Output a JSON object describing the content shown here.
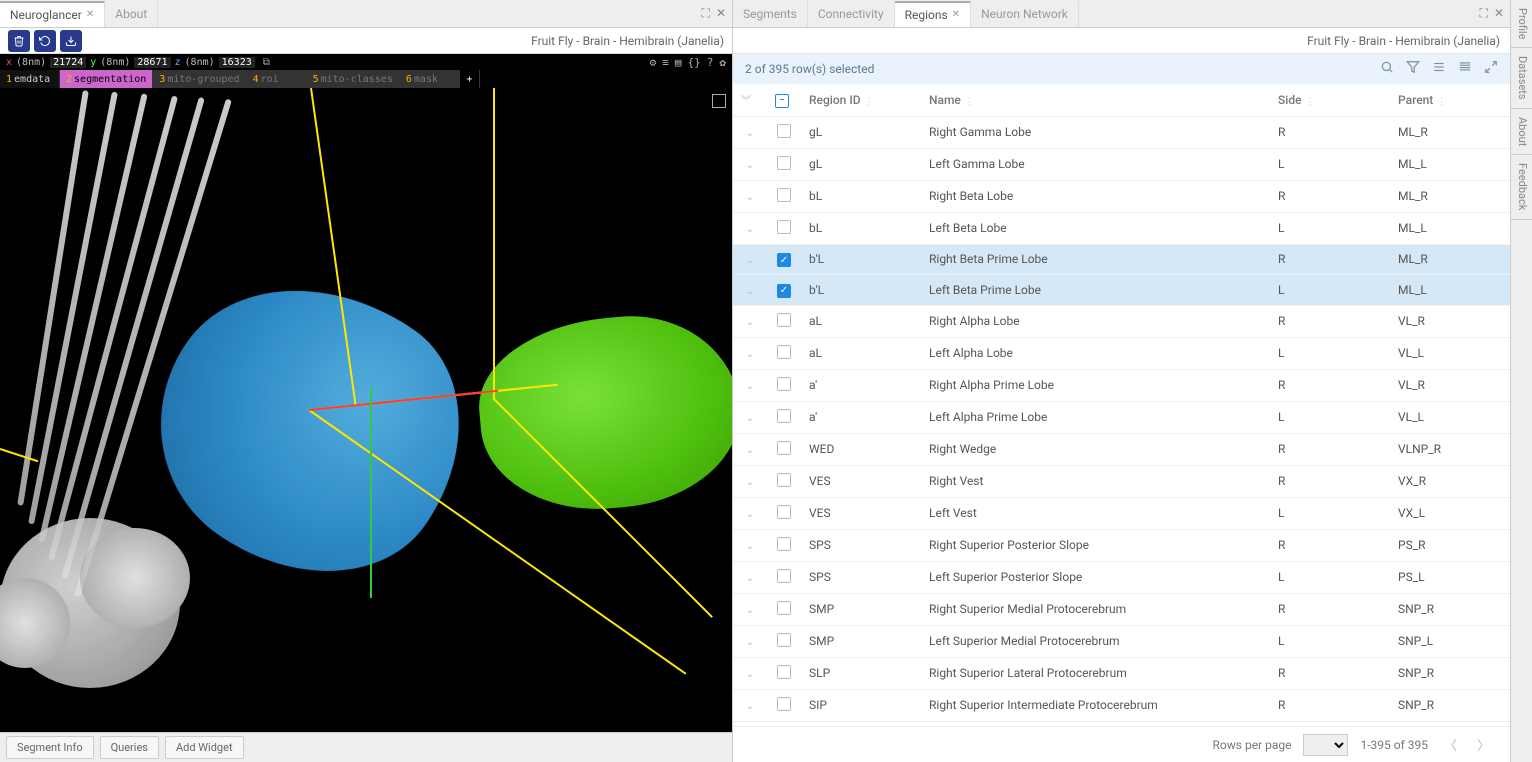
{
  "left": {
    "tabs": [
      {
        "label": "Neuroglancer",
        "active": true,
        "closeable": true
      },
      {
        "label": "About",
        "active": false,
        "closeable": false
      }
    ],
    "breadcrumb": "Fruit Fly - Brain - Hemibrain (Janelia)",
    "coord": {
      "x": {
        "label": "x",
        "unit": "(8nm)",
        "value": "21724"
      },
      "y": {
        "label": "y",
        "unit": "(8nm)",
        "value": "28671"
      },
      "z": {
        "label": "z",
        "unit": "(8nm)",
        "value": "16323"
      }
    },
    "layers": [
      {
        "num": "1",
        "name": "emdata",
        "cls": "emdata"
      },
      {
        "num": "2",
        "name": "segmentation",
        "cls": "seg"
      },
      {
        "num": "3",
        "name": "mito-grouped",
        "cls": "faded"
      },
      {
        "num": "4",
        "name": "roi",
        "cls": "faded"
      },
      {
        "num": "5",
        "name": "mito-classes",
        "cls": "faded"
      },
      {
        "num": "6",
        "name": "mask",
        "cls": "faded"
      }
    ],
    "bottomButtons": [
      "Segment Info",
      "Queries",
      "Add Widget"
    ]
  },
  "right": {
    "tabs": [
      {
        "label": "Segments",
        "active": false
      },
      {
        "label": "Connectivity",
        "active": false
      },
      {
        "label": "Regions",
        "active": true,
        "closeable": true
      },
      {
        "label": "Neuron Network",
        "active": false
      }
    ],
    "breadcrumb": "Fruit Fly - Brain - Hemibrain (Janelia)",
    "selectionText": "2 of 395 row(s) selected",
    "columns": [
      "Region ID",
      "Name",
      "Side",
      "Parent"
    ],
    "rows": [
      {
        "id": "gL",
        "name": "Right Gamma Lobe",
        "side": "R",
        "parent": "ML_R",
        "selected": false
      },
      {
        "id": "gL",
        "name": "Left Gamma Lobe",
        "side": "L",
        "parent": "ML_L",
        "selected": false
      },
      {
        "id": "bL",
        "name": "Right Beta Lobe",
        "side": "R",
        "parent": "ML_R",
        "selected": false
      },
      {
        "id": "bL",
        "name": "Left Beta Lobe",
        "side": "L",
        "parent": "ML_L",
        "selected": false
      },
      {
        "id": "b'L",
        "name": "Right Beta Prime Lobe",
        "side": "R",
        "parent": "ML_R",
        "selected": true
      },
      {
        "id": "b'L",
        "name": "Left Beta Prime Lobe",
        "side": "L",
        "parent": "ML_L",
        "selected": true
      },
      {
        "id": "aL",
        "name": "Right Alpha Lobe",
        "side": "R",
        "parent": "VL_R",
        "selected": false
      },
      {
        "id": "aL",
        "name": "Left Alpha Lobe",
        "side": "L",
        "parent": "VL_L",
        "selected": false
      },
      {
        "id": "a'",
        "name": "Right Alpha Prime Lobe",
        "side": "R",
        "parent": "VL_R",
        "selected": false
      },
      {
        "id": "a'",
        "name": "Left Alpha Prime Lobe",
        "side": "L",
        "parent": "VL_L",
        "selected": false
      },
      {
        "id": "WED",
        "name": "Right Wedge",
        "side": "R",
        "parent": "VLNP_R",
        "selected": false
      },
      {
        "id": "VES",
        "name": "Right Vest",
        "side": "R",
        "parent": "VX_R",
        "selected": false
      },
      {
        "id": "VES",
        "name": "Left Vest",
        "side": "L",
        "parent": "VX_L",
        "selected": false
      },
      {
        "id": "SPS",
        "name": "Right Superior Posterior Slope",
        "side": "R",
        "parent": "PS_R",
        "selected": false
      },
      {
        "id": "SPS",
        "name": "Left Superior Posterior Slope",
        "side": "L",
        "parent": "PS_L",
        "selected": false
      },
      {
        "id": "SMP",
        "name": "Right Superior Medial Protocerebrum",
        "side": "R",
        "parent": "SNP_R",
        "selected": false
      },
      {
        "id": "SMP",
        "name": "Left Superior Medial Protocerebrum",
        "side": "L",
        "parent": "SNP_L",
        "selected": false
      },
      {
        "id": "SLP",
        "name": "Right Superior Lateral Protocerebrum",
        "side": "R",
        "parent": "SNP_R",
        "selected": false
      },
      {
        "id": "SIP",
        "name": "Right Superior Intermediate Protocerebrum",
        "side": "R",
        "parent": "SNP_R",
        "selected": false
      }
    ],
    "pager": {
      "rowsLabel": "Rows per page",
      "rangeText": "1-395 of 395"
    },
    "sideTabs": [
      "Profile",
      "Datasets",
      "About",
      "Feedback"
    ]
  }
}
